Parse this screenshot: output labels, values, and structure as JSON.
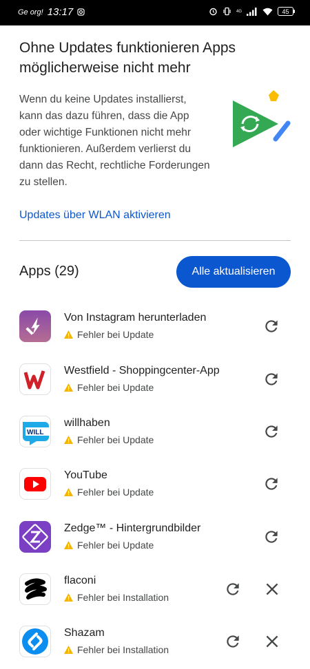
{
  "status_bar": {
    "carrier": "Ge org!",
    "time": "13:17",
    "network": "4G",
    "battery": "45"
  },
  "header": {
    "title": "Ohne Updates funktionieren Apps möglicherweise nicht mehr",
    "description": "Wenn du keine Updates installierst, kann das dazu führen, dass die App oder wichtige Funktionen nicht mehr funktionieren. Außerdem verlierst du dann das Recht, rechtliche Forderungen zu stellen.",
    "wlan_link": "Updates über WLAN aktivieren"
  },
  "apps": {
    "title": "Apps (29)",
    "update_all": "Alle aktualisieren",
    "items": [
      {
        "name": "Von Instagram herunterladen",
        "status": "Fehler bei Update",
        "icon": "instagram-download-icon"
      },
      {
        "name": "Westfield - Shoppingcenter-App",
        "status": "Fehler bei Update",
        "icon": "westfield-icon"
      },
      {
        "name": "willhaben",
        "status": "Fehler bei Update",
        "icon": "willhaben-icon"
      },
      {
        "name": "YouTube",
        "status": "Fehler bei Update",
        "icon": "youtube-icon"
      },
      {
        "name": "Zedge™ - Hintergrundbilder",
        "status": "Fehler bei Update",
        "icon": "zedge-icon"
      },
      {
        "name": "flaconi",
        "status": "Fehler bei Installation",
        "icon": "flaconi-icon"
      },
      {
        "name": "Shazam",
        "status": "Fehler bei Installation",
        "icon": "shazam-icon"
      }
    ],
    "willhaben_icon_text": "WILL"
  },
  "colors": {
    "accent": "#0b57d0",
    "warning": "#f4b400",
    "text_secondary": "#444746"
  }
}
